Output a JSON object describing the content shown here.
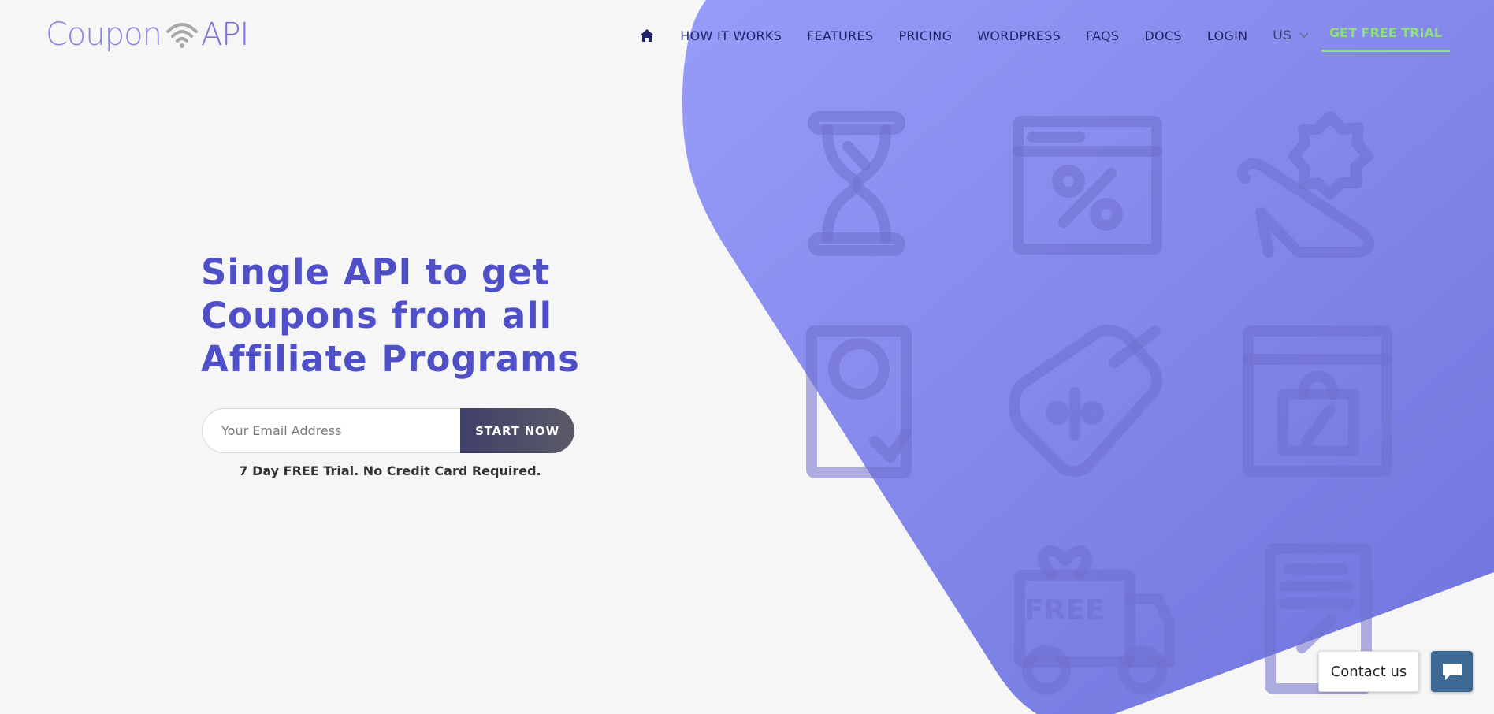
{
  "brand": {
    "logo_left": "Coupon",
    "logo_right": "API"
  },
  "nav": {
    "items": [
      "HOW IT WORKS",
      "FEATURES",
      "PRICING",
      "WORDPRESS",
      "FAQS",
      "DOCS",
      "LOGIN"
    ],
    "lang": "US",
    "trial_label": "GET FREE TRIAL",
    "home_icon": "home-icon"
  },
  "hero": {
    "title_line1": "Single API to get",
    "title_line2": "Coupons from all",
    "title_line3": "Affiliate Programs",
    "email_placeholder": "Your Email Address",
    "start_label": "START NOW",
    "note": "7 Day FREE Trial. No Credit Card Required.",
    "free_badge": "FREE"
  },
  "contact": {
    "label": "Contact us",
    "icon": "chat-icon"
  },
  "colors": {
    "accent": "#4f4fc8",
    "hero_blob_top": "#979bf8",
    "hero_blob_bottom": "#6f74dc",
    "trial": "#8ee07d",
    "nav_text": "#1f2266"
  }
}
